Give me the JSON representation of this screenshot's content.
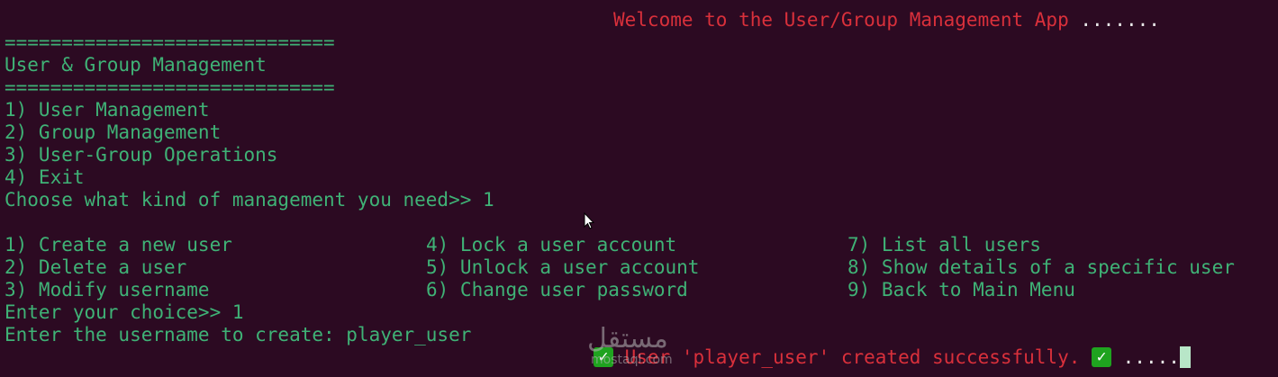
{
  "welcome": {
    "text": "Welcome to the User/Group Management App",
    "dots": " ......."
  },
  "main_menu": {
    "separator": "=============================",
    "title": "User & Group Management",
    "items": [
      "1) User Management",
      "2) Group Management",
      "3) User-Group Operations",
      "4) Exit"
    ],
    "prompt": "Choose what kind of management you need>> 1"
  },
  "user_menu": {
    "col1": [
      "1) Create a new user",
      "2) Delete a user",
      "3) Modify username"
    ],
    "col2": [
      "4) Lock a user account",
      "5) Unlock a user account",
      "6) Change user password"
    ],
    "col3": [
      "7) List all users",
      "8) Show details of a specific user",
      "9) Back to Main Menu"
    ],
    "prompt": "Enter your choice>> 1",
    "username_prompt": "Enter the username to create: player_user"
  },
  "result": {
    "message": " User 'player_user' created successfully. ",
    "dots": " .....",
    "check_icon": "check-icon"
  },
  "watermark": {
    "arabic": "مستقل",
    "site": "mostaql.com"
  },
  "colors": {
    "background": "#2c0a22",
    "text_green": "#3fb276",
    "text_red": "#d9303b",
    "check_green": "#1fa31f",
    "cursor": "#b8e6c8"
  }
}
